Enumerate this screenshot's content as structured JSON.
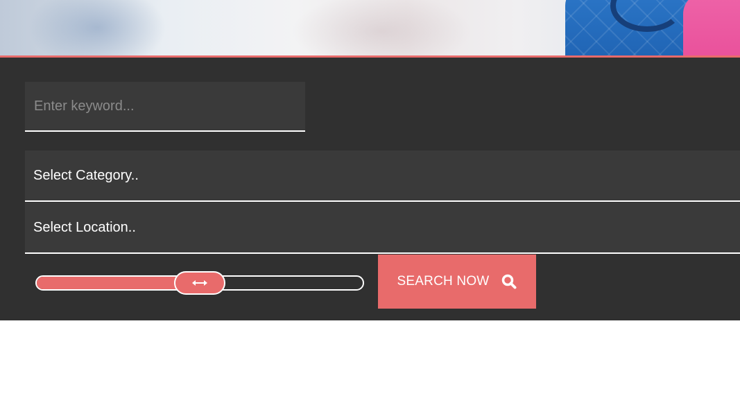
{
  "search": {
    "keyword_placeholder": "Enter keyword...",
    "keyword_value": "",
    "category_label": "Select Category..",
    "location_label": "Select Location..",
    "range_slider": {
      "value_fraction": 0.5
    },
    "submit_label": "SEARCH NOW"
  },
  "icons": {
    "slider_handle": "horizontal-arrows-icon",
    "submit": "search-icon"
  },
  "colors": {
    "accent": "#e86b6b",
    "panel_bg": "#303030",
    "field_bg": "#3a3a3a",
    "text": "#ffffff",
    "placeholder": "#8b8b8b"
  }
}
